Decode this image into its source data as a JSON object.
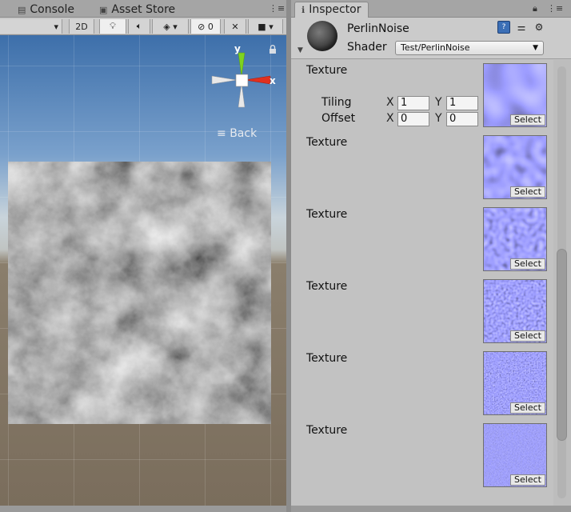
{
  "left_tabs": {
    "console": "Console",
    "asset_store": "Asset Store"
  },
  "inspector_tab": "Inspector",
  "scene_toolbar": {
    "mode_2d": "2D",
    "hidden_count": "0"
  },
  "scene": {
    "back_label": "Back",
    "gizmo_y": "y",
    "gizmo_x": "x"
  },
  "material": {
    "name": "PerlinNoise",
    "shader_label": "Shader",
    "shader_value": "Test/PerlinNoise"
  },
  "tiling": {
    "label": "Tiling",
    "x_label": "X",
    "y_label": "Y",
    "x": "1",
    "y": "1"
  },
  "offset": {
    "label": "Offset",
    "x_label": "X",
    "y_label": "Y",
    "x": "0",
    "y": "0"
  },
  "textures": [
    {
      "label": "Texture",
      "select": "Select"
    },
    {
      "label": "Texture",
      "select": "Select"
    },
    {
      "label": "Texture",
      "select": "Select"
    },
    {
      "label": "Texture",
      "select": "Select"
    },
    {
      "label": "Texture",
      "select": "Select"
    },
    {
      "label": "Texture",
      "select": "Select"
    }
  ],
  "colors": {
    "texture_blue": "#5a5ce0",
    "gizmo_y": "#7ed31f",
    "gizmo_x": "#e0301e",
    "sky": "#3d6faa"
  }
}
